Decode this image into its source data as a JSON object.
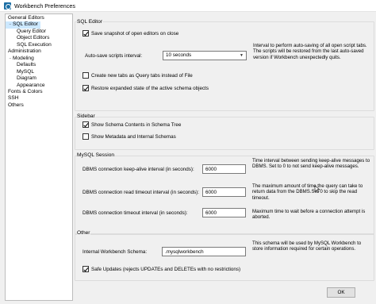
{
  "window": {
    "title": "Workbench Preferences"
  },
  "tree": {
    "items": [
      {
        "label": "General Editors",
        "level": 0
      },
      {
        "label": "SQL Editor",
        "level": 0,
        "toggle": "−",
        "selected": true
      },
      {
        "label": "Query Editor",
        "level": 1
      },
      {
        "label": "Object Editors",
        "level": 1
      },
      {
        "label": "SQL Execution",
        "level": 1
      },
      {
        "label": "Administration",
        "level": 0
      },
      {
        "label": "Modeling",
        "level": 0,
        "toggle": "−"
      },
      {
        "label": "Defaults",
        "level": 1
      },
      {
        "label": "MySQL",
        "level": 1
      },
      {
        "label": "Diagram",
        "level": 1
      },
      {
        "label": "Appearance",
        "level": 1
      },
      {
        "label": "Fonts & Colors",
        "level": 0
      },
      {
        "label": "SSH",
        "level": 0
      },
      {
        "label": "Others",
        "level": 0
      }
    ]
  },
  "sql_editor": {
    "title": "SQL Editor",
    "save_snapshot": {
      "label": "Save snapshot of open editors on close",
      "checked": true
    },
    "autosave_label": "Auto-save scripts interval:",
    "autosave_value": "10 seconds",
    "autosave_desc": "Interval to perform auto-saving of all open script tabs. The scripts will be restored from the last auto-saved version if Workbench unexpectedly quits.",
    "create_new_tabs": {
      "label": "Create new tabs as Query tabs instead of File",
      "checked": false
    },
    "restore_state": {
      "label": "Restore expanded state of the active schema objects",
      "checked": true
    }
  },
  "sidebar": {
    "title": "Sidebar",
    "show_schema_contents": {
      "label": "Show Schema Contents in Schema Tree",
      "checked": true
    },
    "show_metadata": {
      "label": "Show Metadata and Internal Schemas",
      "checked": false
    }
  },
  "mysql_session": {
    "title": "MySQL Session",
    "keepalive": {
      "label": "DBMS connection keep-alive interval (in seconds):",
      "value": "6000",
      "desc": "Time interval between sending keep-alive messages to DBMS. Set to 0 to not send keep-alive messages."
    },
    "read_timeout": {
      "label": "DBMS connection read timeout interval (in seconds):",
      "value": "6000",
      "desc": "The maximum amount of time the query can take to return data from the DBMS.Set 0 to skip the read timeout."
    },
    "conn_timeout": {
      "label": "DBMS connection timeout interval (in seconds):",
      "value": "6000",
      "desc": "Maximum time to wait before a connection attempt is aborted."
    }
  },
  "other": {
    "title": "Other",
    "schema_label": "Internal Workbench Schema:",
    "schema_value": ".mysqlworkbench",
    "schema_desc": "This schema will be used by MySQL Workbench to store information required for certain operations.",
    "safe_updates": {
      "label": "Safe Updates (rejects UPDATEs and DELETEs with no restrictions)",
      "checked": true
    }
  },
  "buttons": {
    "ok": "OK"
  }
}
